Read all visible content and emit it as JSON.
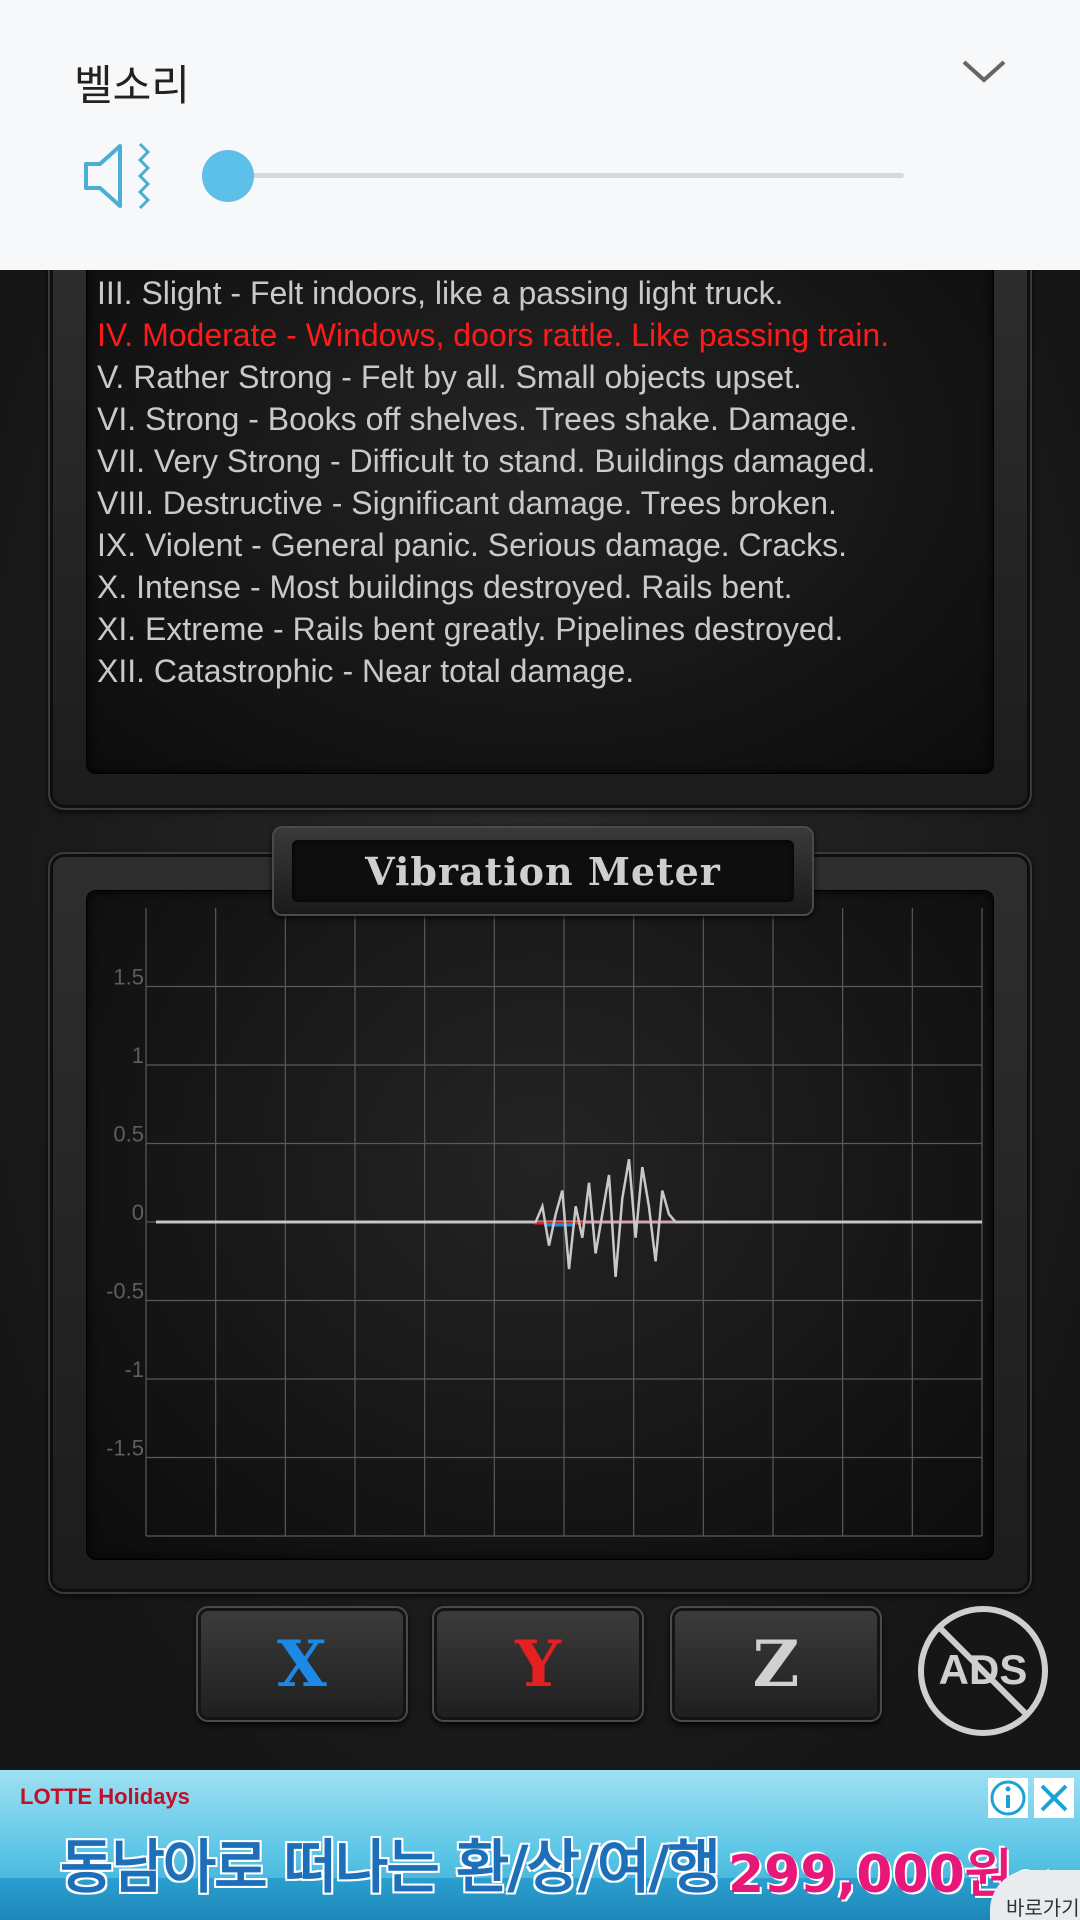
{
  "volume": {
    "title": "벨소리",
    "level": 0,
    "accent": "#5cc0e8",
    "speaker_icon": "muted-speaker-vibrate-icon",
    "collapse_icon": "chevron-down-icon"
  },
  "scale": {
    "items": [
      {
        "text": "III. Slight - Felt indoors, like a passing light truck.",
        "active": false
      },
      {
        "text": "IV. Moderate - Windows, doors rattle. Like passing train.",
        "active": true
      },
      {
        "text": "V. Rather Strong - Felt by all. Small objects upset.",
        "active": false
      },
      {
        "text": "VI. Strong - Books off shelves. Trees shake. Damage.",
        "active": false
      },
      {
        "text": "VII. Very Strong - Difficult to stand. Buildings damaged.",
        "active": false
      },
      {
        "text": "VIII. Destructive - Significant damage. Trees broken.",
        "active": false
      },
      {
        "text": "IX. Violent - General panic. Serious damage. Cracks.",
        "active": false
      },
      {
        "text": "X. Intense - Most buildings destroyed. Rails bent.",
        "active": false
      },
      {
        "text": "XI. Extreme - Rails bent greatly. Pipelines destroyed.",
        "active": false
      },
      {
        "text": "XII. Catastrophic - Near total damage.",
        "active": false
      }
    ],
    "active_color": "#ff1a1a"
  },
  "meter": {
    "title": "Vibration Meter"
  },
  "chart_data": {
    "type": "line",
    "ylim": [
      -2,
      2
    ],
    "y_ticks": [
      "1.5",
      "1",
      "0.5",
      "0",
      "-0.5",
      "-1",
      "-1.5"
    ],
    "y_tick_values": [
      1.5,
      1,
      0.5,
      0,
      -0.5,
      -1,
      -1.5
    ],
    "grid": true,
    "series": [
      {
        "color": "#c8c8c8",
        "values": [
          0,
          0,
          0,
          0,
          0,
          0,
          0,
          0,
          0,
          0,
          0,
          0,
          0,
          0,
          0,
          0,
          0,
          0,
          0,
          0,
          0,
          0,
          0,
          0,
          0,
          0,
          0,
          0,
          0,
          0,
          0,
          0,
          0,
          0,
          0,
          0,
          0,
          0,
          0,
          0,
          0,
          0,
          0,
          0,
          0,
          0,
          0,
          0,
          0,
          0,
          0,
          0,
          0,
          0,
          0,
          0,
          0,
          0,
          0.1,
          -0.15,
          0.05,
          0.2,
          -0.3,
          0.1,
          -0.1,
          0.25,
          -0.2,
          0.05,
          0.3,
          -0.35,
          0.15,
          0.4,
          -0.1,
          0.35,
          0.1,
          -0.25,
          0.2,
          0.05,
          0,
          0,
          0,
          0,
          0,
          0,
          0,
          0,
          0,
          0,
          0,
          0,
          0,
          0,
          0,
          0,
          0,
          0,
          0,
          0,
          0,
          0,
          0,
          0,
          0,
          0,
          0,
          0,
          0,
          0,
          0,
          0,
          0,
          0,
          0,
          0,
          0,
          0,
          0,
          0,
          0,
          0,
          0,
          0,
          0,
          0,
          0
        ]
      },
      {
        "color": "#e52020",
        "values": [
          0
        ]
      },
      {
        "color": "#1e88e5",
        "values": [
          0
        ]
      }
    ]
  },
  "buttons": {
    "x": "X",
    "y": "Y",
    "z": "Z",
    "ads": "ADS"
  },
  "ad": {
    "brand": "LOTTE Holidays",
    "headline": "동남아로 떠나는 환/상/여/행",
    "price": "299,000원~",
    "go": "바로가기",
    "info_icon": "info-icon",
    "close_icon": "close-icon"
  }
}
